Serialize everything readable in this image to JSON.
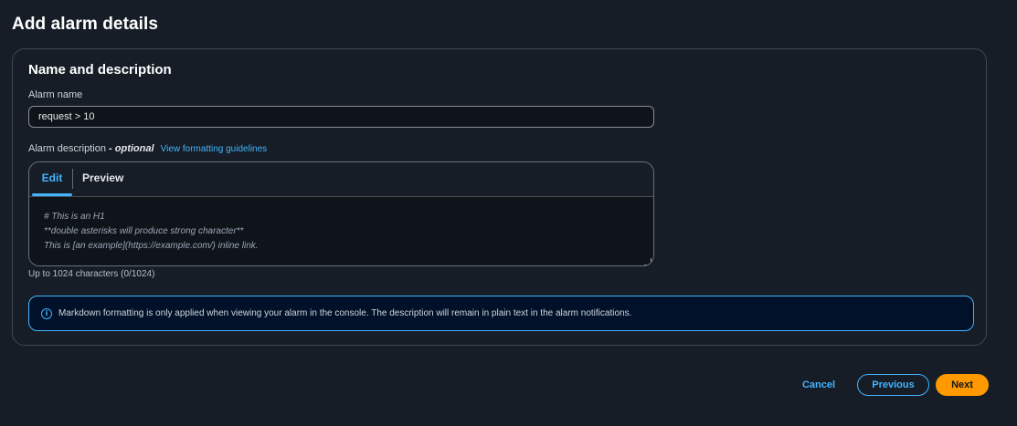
{
  "page": {
    "title": "Add alarm details"
  },
  "name_section": {
    "title": "Name and description",
    "alarm_name_label": "Alarm name",
    "alarm_name_value": "request > 10",
    "description_label": "Alarm description",
    "description_optional": "- optional",
    "formatting_link": "View formatting guidelines",
    "tabs": [
      {
        "label": "Edit",
        "selected": true
      },
      {
        "label": "Preview",
        "selected": false
      }
    ],
    "description_placeholder_lines": [
      "# This is an H1",
      "**double asterisks will produce strong character**",
      "This is [an example](https://example.com/) inline link."
    ],
    "char_count": "Up to 1024 characters (0/1024)",
    "info_alert": "Markdown formatting is only applied when viewing your alarm in the console. The description will remain in plain text in the alarm notifications."
  },
  "footer": {
    "cancel_label": "Cancel",
    "previous_label": "Previous",
    "next_label": "Next"
  },
  "colors": {
    "background": "#161d26",
    "accent_link": "#42b4ff",
    "primary_button": "#ff9900",
    "info_background": "#001129"
  },
  "icons": {
    "info": "info-circle-icon"
  }
}
